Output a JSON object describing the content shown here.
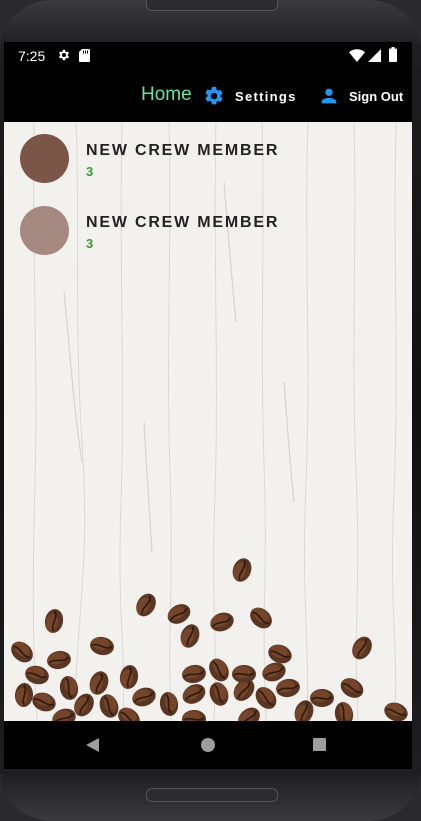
{
  "status_bar": {
    "time": "7:25",
    "icons": [
      "gear-icon",
      "sd-card-icon",
      "wifi-icon",
      "signal-icon",
      "battery-icon"
    ]
  },
  "app_bar": {
    "title": "Home",
    "settings_label": "Settings",
    "signout_label": "Sign Out",
    "title_color": "#66e3a4",
    "icon_color": "#2196f3"
  },
  "crew": {
    "items": [
      {
        "name": "NEW CREW MEMBER",
        "count": "3",
        "avatar_color": "#7a5548"
      },
      {
        "name": "NEW CREW MEMBER",
        "count": "3",
        "avatar_color": "#a58880"
      }
    ]
  },
  "nav_bar": {
    "buttons": [
      "back-icon",
      "home-icon",
      "recents-icon"
    ]
  }
}
